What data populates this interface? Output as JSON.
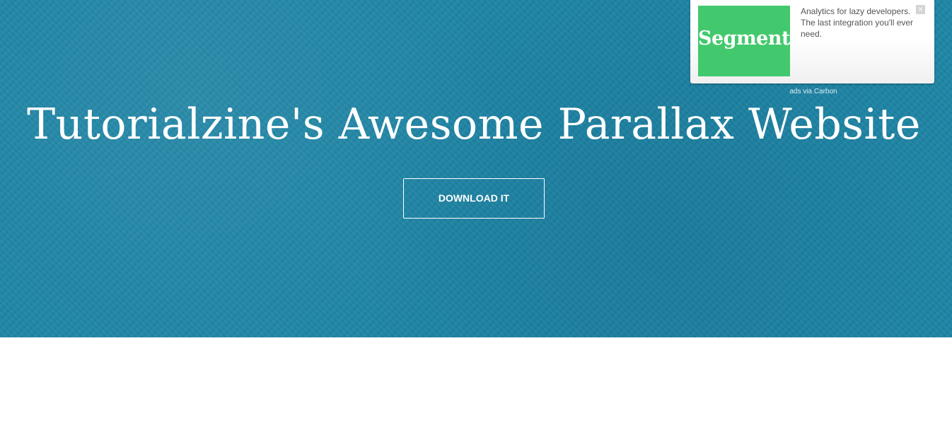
{
  "hero": {
    "title": "Tutorialzine's Awesome Parallax Website",
    "download_label": "DOWNLOAD IT",
    "background_color": "#1f86a6"
  },
  "ad": {
    "logo_text": "Segment",
    "logo_color": "#43c96d",
    "text": "Analytics for lazy developers. The last integration you'll ever need.",
    "close_icon": "close-icon",
    "close_glyph": "×",
    "via_label": "ads via Carbon"
  }
}
